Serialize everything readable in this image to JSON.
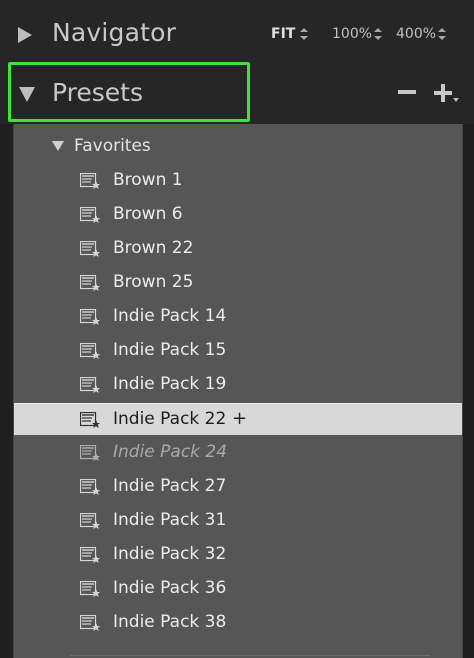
{
  "navigator": {
    "title": "Navigator",
    "zoom_options": [
      "FIT",
      "100%",
      "400%"
    ],
    "expanded": false
  },
  "presets": {
    "title": "Presets",
    "remove_label": "−",
    "add_label": "+",
    "highlight_color": "#3ae63a",
    "expanded": true,
    "folder": {
      "name": "Favorites",
      "expanded": true,
      "items": [
        {
          "label": "Brown 1",
          "state": "normal"
        },
        {
          "label": "Brown 6",
          "state": "normal"
        },
        {
          "label": "Brown 22",
          "state": "normal"
        },
        {
          "label": "Brown 25",
          "state": "normal"
        },
        {
          "label": "Indie Pack 14",
          "state": "normal"
        },
        {
          "label": "Indie Pack 15",
          "state": "normal"
        },
        {
          "label": "Indie Pack 19",
          "state": "normal"
        },
        {
          "label": "Indie Pack 22",
          "state": "selected",
          "suffix": "+"
        },
        {
          "label": "Indie Pack 24",
          "state": "disabled"
        },
        {
          "label": "Indie Pack 27",
          "state": "normal"
        },
        {
          "label": "Indie Pack 31",
          "state": "normal"
        },
        {
          "label": "Indie Pack 32",
          "state": "normal"
        },
        {
          "label": "Indie Pack 36",
          "state": "normal"
        },
        {
          "label": "Indie Pack 38",
          "state": "normal"
        }
      ]
    }
  },
  "icons": {
    "navigator_toggle": "triangle-right-icon",
    "presets_toggle": "triangle-down-icon",
    "preset_item": "preset-star-icon"
  }
}
